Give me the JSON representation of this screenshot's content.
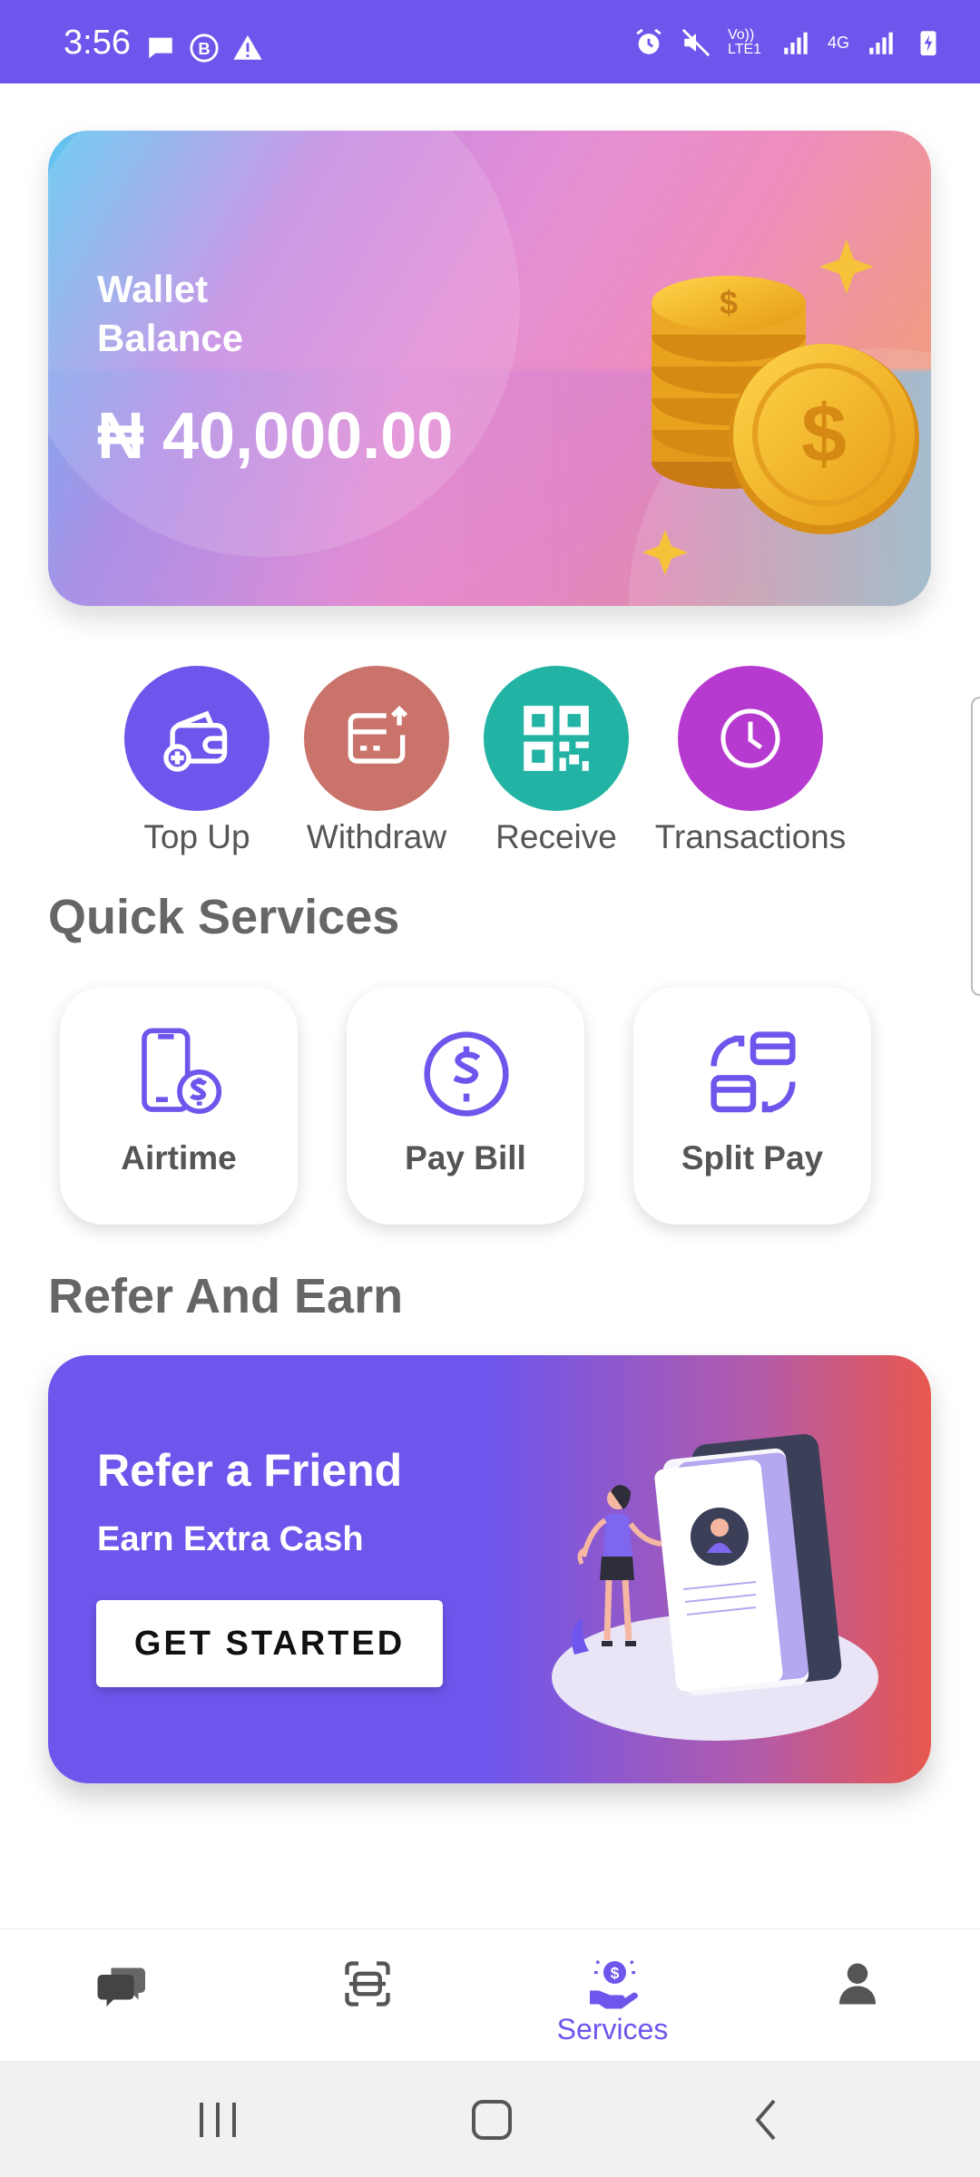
{
  "status_bar": {
    "time": "3:56",
    "left_icons": [
      "chat-bubble-icon",
      "b-icon",
      "warning-icon"
    ],
    "right_icons": [
      "alarm-icon",
      "mute-icon",
      "volte-icon",
      "signal-icon",
      "4g-icon",
      "signal-icon",
      "battery-charging-icon"
    ],
    "network_1": "Vo)) LTE1",
    "network_2": "4G"
  },
  "wallet": {
    "title": "Wallet\nBalance",
    "amount": "₦ 40,000.00"
  },
  "actions": [
    {
      "label": "Top Up",
      "icon": "wallet-add-icon",
      "color": "#6E56EC"
    },
    {
      "label": "Withdraw",
      "icon": "card-upload-icon",
      "color": "#C9736B"
    },
    {
      "label": "Receive",
      "icon": "qr-code-icon",
      "color": "#22B3A4"
    },
    {
      "label": "Transactions",
      "icon": "clock-icon",
      "color": "#B73AD0"
    }
  ],
  "quick_services": {
    "title": "Quick Services",
    "items": [
      {
        "label": "Airtime",
        "icon": "phone-dollar-icon"
      },
      {
        "label": "Pay Bill",
        "icon": "dollar-circle-icon"
      },
      {
        "label": "Split Pay",
        "icon": "split-pay-icon"
      }
    ]
  },
  "refer": {
    "section_title": "Refer And Earn",
    "title": "Refer a Friend",
    "subtitle": "Earn Extra Cash",
    "button": "GET STARTED"
  },
  "bottom_nav": {
    "items": [
      {
        "icon": "chat-icon",
        "label": ""
      },
      {
        "icon": "scan-icon",
        "label": ""
      },
      {
        "icon": "services-icon",
        "label": "Services",
        "active": true
      },
      {
        "icon": "profile-icon",
        "label": ""
      }
    ]
  },
  "colors": {
    "primary": "#6E56EC"
  }
}
